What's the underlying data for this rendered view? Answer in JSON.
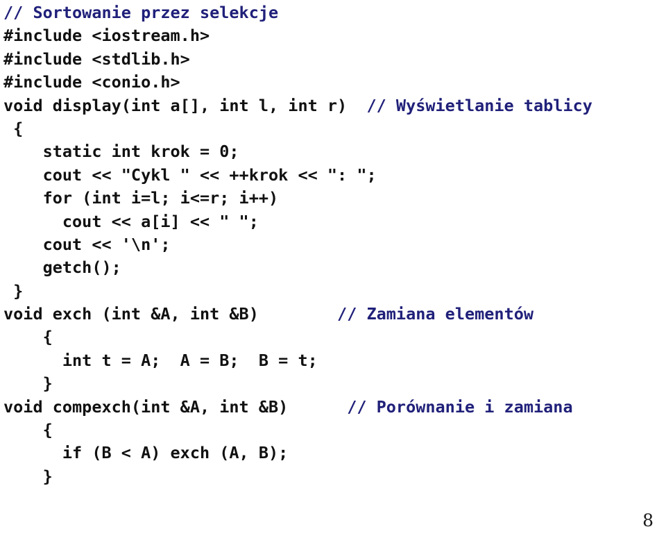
{
  "slide": {
    "page_number": "8",
    "colors": {
      "background": "#ffffff",
      "code_text": "#111111",
      "comment_text": "#20207a",
      "page_number_text": "#1a1a1a"
    },
    "language": "cpp",
    "lines": [
      {
        "code": "",
        "comment": "// Sortowanie przez selekcje"
      },
      {
        "code": "#include <iostream.h>",
        "comment": ""
      },
      {
        "code": "#include <stdlib.h>",
        "comment": ""
      },
      {
        "code": "#include <conio.h>",
        "comment": ""
      },
      {
        "code": "void display(int a[], int l, int r)  ",
        "comment": "// Wyświetlanie tablicy"
      },
      {
        "code": " {",
        "comment": ""
      },
      {
        "code": "    static int krok = 0;",
        "comment": ""
      },
      {
        "code": "    cout << \"Cykl \" << ++krok << \": \";",
        "comment": ""
      },
      {
        "code": "    for (int i=l; i<=r; i++)",
        "comment": ""
      },
      {
        "code": "      cout << a[i] << \" \";",
        "comment": ""
      },
      {
        "code": "    cout << '\\n';",
        "comment": ""
      },
      {
        "code": "    getch();",
        "comment": ""
      },
      {
        "code": " }",
        "comment": ""
      },
      {
        "code": "void exch (int &A, int &B)        ",
        "comment": "// Zamiana elementów"
      },
      {
        "code": "    {",
        "comment": ""
      },
      {
        "code": "      int t = A;  A = B;  B = t;",
        "comment": ""
      },
      {
        "code": "    }",
        "comment": ""
      },
      {
        "code": "void compexch(int &A, int &B)      ",
        "comment": "// Porównanie i zamiana"
      },
      {
        "code": "    {",
        "comment": ""
      },
      {
        "code": "      if (B < A) exch (A, B);",
        "comment": ""
      },
      {
        "code": "    }",
        "comment": ""
      }
    ]
  }
}
